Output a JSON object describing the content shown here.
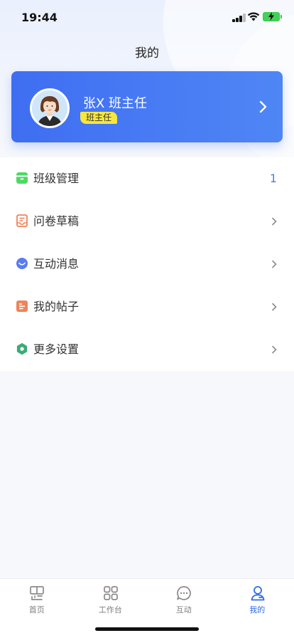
{
  "status_bar": {
    "time": "19:44"
  },
  "header": {
    "title": "我的"
  },
  "profile": {
    "name": "张X 班主任",
    "role_badge": "班主任"
  },
  "menu": {
    "items": [
      {
        "label": "班级管理",
        "icon": "class-icon",
        "color": "#4cd964",
        "count": "1"
      },
      {
        "label": "问卷草稿",
        "icon": "draft-icon",
        "color": "#f0845a"
      },
      {
        "label": "互动消息",
        "icon": "message-icon",
        "color": "#5a7cf0"
      },
      {
        "label": "我的帖子",
        "icon": "post-icon",
        "color": "#f0845a"
      },
      {
        "label": "更多设置",
        "icon": "settings-icon",
        "color": "#3cab78"
      }
    ]
  },
  "tab_bar": {
    "active": "我的",
    "tabs": [
      {
        "label": "首页",
        "icon": "home-icon"
      },
      {
        "label": "工作台",
        "icon": "workbench-icon"
      },
      {
        "label": "互动",
        "icon": "chat-icon"
      },
      {
        "label": "我的",
        "icon": "profile-icon"
      }
    ]
  },
  "colors": {
    "accent": "#2e6ce6",
    "card_start": "#3f6ef2",
    "card_end": "#4f86f5",
    "badge": "#f7e63f"
  }
}
